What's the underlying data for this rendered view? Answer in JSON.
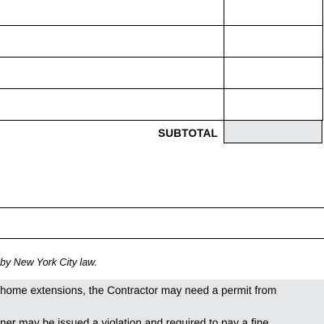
{
  "table": {
    "subtotal_label": "SUBTOTAL"
  },
  "notes": {
    "law_text": "by New York City law."
  },
  "notice": {
    "line1": "home extensions, the Contractor may need a permit from",
    "line2": "ner may be issued a violation and required to pay a fine"
  },
  "colors": {
    "shaded_cell": "#e6e7e8",
    "rule": "#000000"
  }
}
